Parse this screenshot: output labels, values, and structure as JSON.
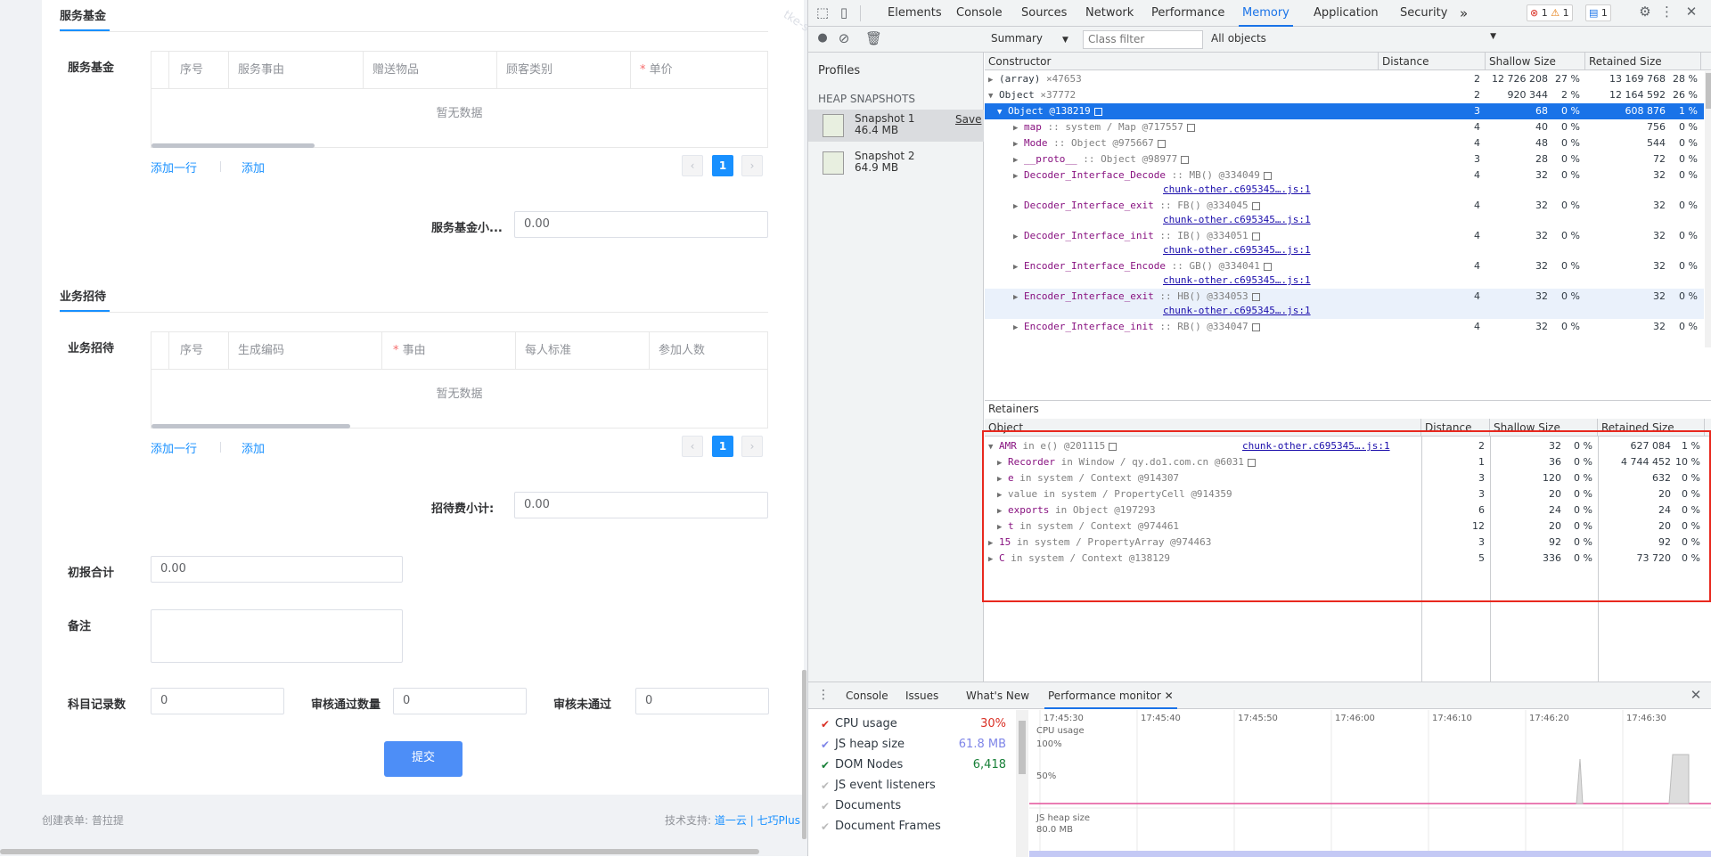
{
  "form": {
    "section_fund": {
      "title": "服务基金",
      "label": "服务基金",
      "columns": [
        "序号",
        "服务事由",
        "赠送物品",
        "顾客类别",
        "单价"
      ],
      "required_col_index": 4,
      "empty": "暂无数据",
      "add_row": "添加一行",
      "add": "添加",
      "page": "1",
      "subtotal_label": "服务基金小...",
      "subtotal_value": "0.00"
    },
    "section_host": {
      "title": "业务招待",
      "label": "业务招待",
      "columns": [
        "序号",
        "生成编码",
        "事由",
        "每人标准",
        "参加人数"
      ],
      "required_col_index": 2,
      "empty": "暂无数据",
      "add_row": "添加一行",
      "add": "添加",
      "page": "1",
      "subtotal_label": "招待费小计:",
      "subtotal_value": "0.00"
    },
    "initial_total_label": "初报合计",
    "initial_total_value": "0.00",
    "remark_label": "备注",
    "remark_value": "",
    "subject_count_label": "科目记录数",
    "subject_count_value": "0",
    "approved_label": "审核通过数量",
    "approved_value": "0",
    "rejected_label": "审核未通过",
    "rejected_value": "0",
    "submit": "提交",
    "watermark": "tke-saas-beta"
  },
  "footer": {
    "creator": "创建表单: 普拉提",
    "support_prefix": "技术支持:",
    "support_links": "道一云 | 七巧Plus"
  },
  "devtools": {
    "tabs": [
      "Elements",
      "Console",
      "Sources",
      "Network",
      "Performance",
      "Memory",
      "Application",
      "Security"
    ],
    "active_tab": "Memory",
    "more": "»",
    "errors": "1",
    "warnings": "1",
    "messages": "1",
    "toolbar": {
      "view": "Summary",
      "class_filter_placeholder": "Class filter",
      "scope": "All objects"
    },
    "sidebar": {
      "profiles": "Profiles",
      "heap_snapshots": "HEAP SNAPSHOTS",
      "save": "Save",
      "snapshots": [
        {
          "name": "Snapshot 1",
          "size": "46.4 MB"
        },
        {
          "name": "Snapshot 2",
          "size": "64.9 MB"
        }
      ]
    },
    "headers": {
      "constructor": "Constructor",
      "distance": "Distance",
      "shallow": "Shallow Size",
      "retained": "Retained Size",
      "retainers": "Retainers",
      "object": "Object"
    },
    "rows": [
      {
        "tri": "▶",
        "name": "(array)",
        "extra": "×47653",
        "d": "2",
        "s": "12 726 208",
        "sp": "27 %",
        "r": "13 169 768",
        "rp": "28 %"
      },
      {
        "tri": "▼",
        "name": "Object",
        "extra": "×37772",
        "d": "2",
        "s": "920 344",
        "sp": "2 %",
        "r": "12 164 592",
        "rp": "26 %"
      },
      {
        "tri": "▼",
        "name": "Object @138219",
        "extra": "",
        "d": "3",
        "s": "68",
        "sp": "0 %",
        "r": "608 876",
        "rp": "1 %"
      },
      {
        "tri": "▶",
        "name": "map",
        "extra": ":: system / Map @717557",
        "d": "4",
        "s": "40",
        "sp": "0 %",
        "r": "756",
        "rp": "0 %"
      },
      {
        "tri": "▶",
        "name": "Mode",
        "extra": ":: Object @975667",
        "d": "4",
        "s": "48",
        "sp": "0 %",
        "r": "544",
        "rp": "0 %"
      },
      {
        "tri": "▶",
        "name": "__proto__",
        "extra": ":: Object @98977",
        "d": "3",
        "s": "28",
        "sp": "0 %",
        "r": "72",
        "rp": "0 %"
      },
      {
        "tri": "▶",
        "name": "Decoder_Interface_Decode",
        "extra": ":: MB() @334049",
        "d": "4",
        "s": "32",
        "sp": "0 %",
        "r": "32",
        "rp": "0 %",
        "link": "chunk-other.c695345….js:1"
      },
      {
        "tri": "▶",
        "name": "Decoder_Interface_exit",
        "extra": ":: FB() @334045",
        "d": "4",
        "s": "32",
        "sp": "0 %",
        "r": "32",
        "rp": "0 %",
        "link": "chunk-other.c695345….js:1"
      },
      {
        "tri": "▶",
        "name": "Decoder_Interface_init",
        "extra": ":: IB() @334051",
        "d": "4",
        "s": "32",
        "sp": "0 %",
        "r": "32",
        "rp": "0 %",
        "link": "chunk-other.c695345….js:1"
      },
      {
        "tri": "▶",
        "name": "Encoder_Interface_Encode",
        "extra": ":: GB() @334041",
        "d": "4",
        "s": "32",
        "sp": "0 %",
        "r": "32",
        "rp": "0 %",
        "link": "chunk-other.c695345….js:1"
      },
      {
        "tri": "▶",
        "name": "Encoder_Interface_exit",
        "extra": ":: HB() @334053",
        "d": "4",
        "s": "32",
        "sp": "0 %",
        "r": "32",
        "rp": "0 %",
        "link": "chunk-other.c695345….js:1"
      },
      {
        "tri": "▶",
        "name": "Encoder_Interface_init",
        "extra": ":: RB() @334047",
        "d": "4",
        "s": "32",
        "sp": "0 %",
        "r": "32",
        "rp": "0 %"
      }
    ],
    "retainers": [
      {
        "tri": "▼",
        "name": "AMR",
        "extra": "in e() @201115",
        "d": "2",
        "s": "32",
        "sp": "0 %",
        "r": "627 084",
        "rp": "1 %",
        "link": "chunk-other.c695345….js:1"
      },
      {
        "tri": "▶",
        "name": "Recorder",
        "extra": "in Window / qy.do1.com.cn @6031",
        "d": "1",
        "s": "36",
        "sp": "0 %",
        "r": "4 744 452",
        "rp": "10 %"
      },
      {
        "tri": "▶",
        "name": "e",
        "extra": "in system / Context @914307",
        "d": "3",
        "s": "120",
        "sp": "0 %",
        "r": "632",
        "rp": "0 %"
      },
      {
        "tri": "▶",
        "name": "value",
        "extra": "in system / PropertyCell @914359",
        "d": "3",
        "s": "20",
        "sp": "0 %",
        "r": "20",
        "rp": "0 %"
      },
      {
        "tri": "▶",
        "name": "exports",
        "extra": "in Object @197293",
        "d": "6",
        "s": "24",
        "sp": "0 %",
        "r": "24",
        "rp": "0 %"
      },
      {
        "tri": "▶",
        "name": "t",
        "extra": "in system / Context @974461",
        "d": "12",
        "s": "20",
        "sp": "0 %",
        "r": "20",
        "rp": "0 %"
      },
      {
        "tri": "▶",
        "name": "15",
        "extra": "in system / PropertyArray @974463",
        "d": "3",
        "s": "92",
        "sp": "0 %",
        "r": "92",
        "rp": "0 %"
      },
      {
        "tri": "▶",
        "name": "C",
        "extra": "in system / Context @138129",
        "d": "5",
        "s": "336",
        "sp": "0 %",
        "r": "73 720",
        "rp": "0 %"
      }
    ],
    "drawer": {
      "tabs": [
        "Console",
        "Issues",
        "What's New",
        "Performance monitor"
      ],
      "active": "Performance monitor",
      "metrics": [
        {
          "label": "CPU usage",
          "value": "30%",
          "color": "#d93025",
          "checked": true
        },
        {
          "label": "JS heap size",
          "value": "61.8 MB",
          "color": "#7f86e8",
          "checked": true
        },
        {
          "label": "DOM Nodes",
          "value": "6,418",
          "color": "#188038",
          "checked": true
        },
        {
          "label": "JS event listeners",
          "value": "",
          "color": "#999999",
          "checked": false
        },
        {
          "label": "Documents",
          "value": "",
          "color": "#999999",
          "checked": false
        },
        {
          "label": "Document Frames",
          "value": "",
          "color": "#999999",
          "checked": false
        }
      ],
      "times": [
        "17:45:30",
        "17:45:40",
        "17:45:50",
        "17:46:00",
        "17:46:10",
        "17:46:20",
        "17:46:30"
      ],
      "cpu_label": "CPU usage",
      "cpu_ticks": [
        "100%",
        "50%"
      ],
      "heap_label": "JS heap size",
      "heap_tick": "80.0 MB"
    }
  }
}
